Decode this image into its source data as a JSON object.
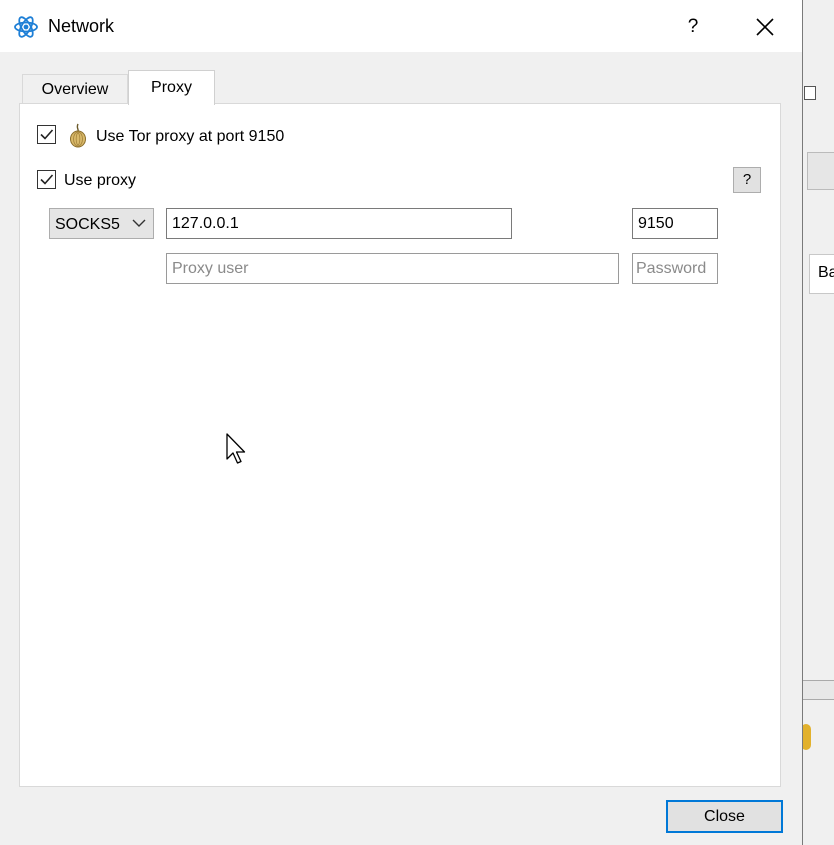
{
  "window": {
    "title": "Network",
    "help_glyph": "?"
  },
  "tabs": [
    {
      "label": "Overview",
      "active": false
    },
    {
      "label": "Proxy",
      "active": true
    }
  ],
  "proxy_tab": {
    "tor_checkbox": {
      "label": "Use Tor proxy at port 9150",
      "checked": true,
      "icon": "onion-icon"
    },
    "proxy_checkbox": {
      "label": "Use proxy",
      "checked": true
    },
    "help_button_label": "?",
    "proxy_type": {
      "selected": "SOCKS5"
    },
    "host": {
      "value": "127.0.0.1"
    },
    "port": {
      "value": "9150"
    },
    "user": {
      "value": "",
      "placeholder": "Proxy user"
    },
    "password": {
      "value": "",
      "placeholder": "Password"
    }
  },
  "footer": {
    "close_label": "Close"
  },
  "background_window": {
    "tab_fragment": "Ba"
  },
  "colors": {
    "accent": "#0078d7",
    "desktop": "#1565c0"
  }
}
